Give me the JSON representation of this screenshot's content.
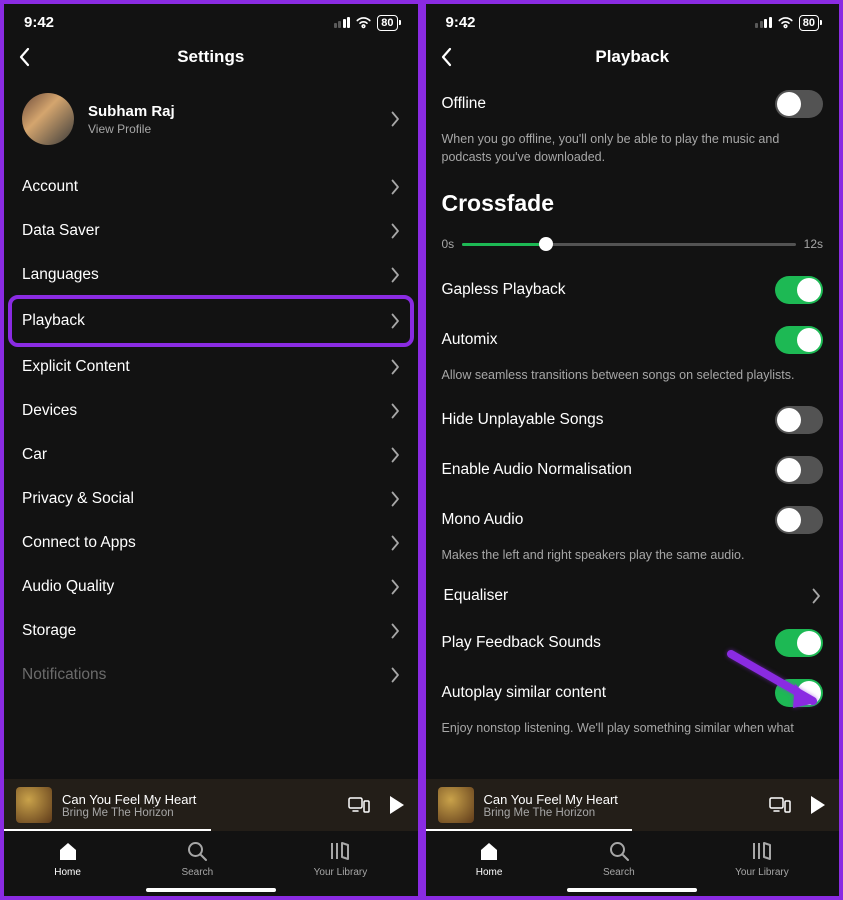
{
  "status": {
    "time": "9:42",
    "battery": "80"
  },
  "screen1": {
    "title": "Settings",
    "profile": {
      "name": "Subham Raj",
      "sub": "View Profile"
    },
    "items": [
      {
        "label": "Account",
        "highlight": false
      },
      {
        "label": "Data Saver",
        "highlight": false
      },
      {
        "label": "Languages",
        "highlight": false
      },
      {
        "label": "Playback",
        "highlight": true
      },
      {
        "label": "Explicit Content",
        "highlight": false
      },
      {
        "label": "Devices",
        "highlight": false
      },
      {
        "label": "Car",
        "highlight": false
      },
      {
        "label": "Privacy & Social",
        "highlight": false
      },
      {
        "label": "Connect to Apps",
        "highlight": false
      },
      {
        "label": "Audio Quality",
        "highlight": false
      },
      {
        "label": "Storage",
        "highlight": false
      },
      {
        "label": "Notifications",
        "highlight": false,
        "faded": true
      }
    ]
  },
  "screen2": {
    "title": "Playback",
    "offline": {
      "label": "Offline",
      "on": false,
      "desc": "When you go offline, you'll only be able to play the music and podcasts you've downloaded."
    },
    "crossfade": {
      "title": "Crossfade",
      "min": "0s",
      "max": "12s"
    },
    "toggles": [
      {
        "label": "Gapless Playback",
        "on": true
      },
      {
        "label": "Automix",
        "on": true,
        "desc": "Allow seamless transitions between songs on selected playlists."
      },
      {
        "label": "Hide Unplayable Songs",
        "on": false
      },
      {
        "label": "Enable Audio Normalisation",
        "on": false
      },
      {
        "label": "Mono Audio",
        "on": false,
        "desc": "Makes the left and right speakers play the same audio."
      }
    ],
    "equaliser": "Equaliser",
    "toggles2": [
      {
        "label": "Play Feedback Sounds",
        "on": true
      },
      {
        "label": "Autoplay similar content",
        "on": true,
        "desc": "Enjoy nonstop listening. We'll play something similar when what"
      }
    ]
  },
  "nowPlaying": {
    "title": "Can You Feel My Heart",
    "artist": "Bring Me The Horizon"
  },
  "nav": {
    "home": "Home",
    "search": "Search",
    "library": "Your Library"
  }
}
